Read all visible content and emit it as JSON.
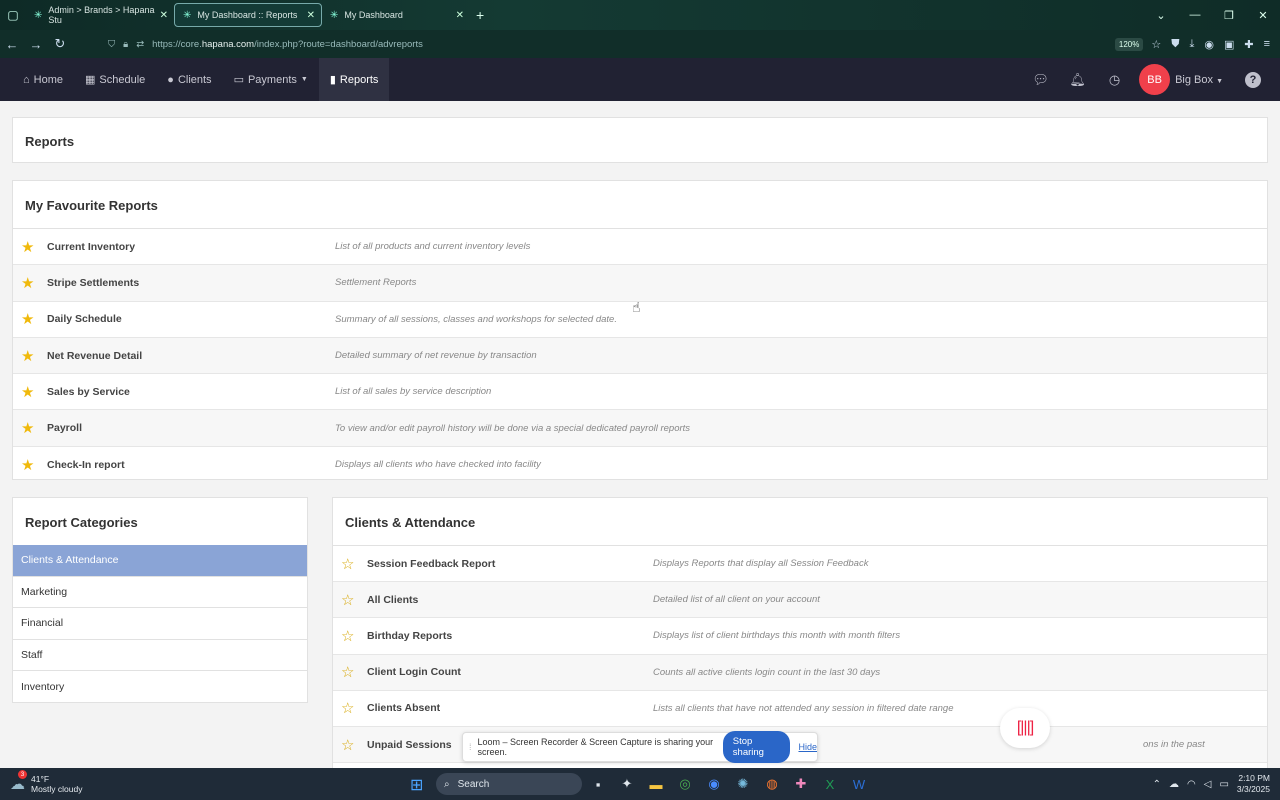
{
  "browser": {
    "tabs": [
      {
        "label": "Admin > Brands > Hapana Stu",
        "active": false
      },
      {
        "label": "My Dashboard :: Reports",
        "active": true
      },
      {
        "label": "My Dashboard",
        "active": false
      }
    ],
    "url_prefix": "https://core.",
    "url_host": "hapana.com",
    "url_path": "/index.php?route=dashboard/advreports",
    "zoom": "120%"
  },
  "nav": {
    "items": [
      {
        "label": "Home",
        "icon": "home-icon"
      },
      {
        "label": "Schedule",
        "icon": "calendar-icon"
      },
      {
        "label": "Clients",
        "icon": "user-icon"
      },
      {
        "label": "Payments",
        "icon": "payment-icon"
      },
      {
        "label": "Reports",
        "icon": "bar-chart-icon"
      }
    ],
    "active": "Reports",
    "avatar_initials": "BB",
    "user_name": "Big Box",
    "help": "?"
  },
  "page": {
    "title": "Reports",
    "favourites_title": "My Favourite Reports",
    "favourites": [
      {
        "name": "Current Inventory",
        "desc": "List of all products and current inventory levels"
      },
      {
        "name": "Stripe Settlements",
        "desc": "Settlement Reports"
      },
      {
        "name": "Daily Schedule",
        "desc": "Summary of all sessions, classes and workshops for selected date."
      },
      {
        "name": "Net Revenue Detail",
        "desc": "Detailed summary of net revenue by transaction"
      },
      {
        "name": "Sales by Service",
        "desc": "List of all sales by service description"
      },
      {
        "name": "Payroll",
        "desc": "To view and/or edit payroll history will be done via a special dedicated payroll reports"
      },
      {
        "name": "Check-In report",
        "desc": "Displays all clients who have checked into facility"
      }
    ],
    "categories_title": "Report Categories",
    "categories": [
      "Clients & Attendance",
      "Marketing",
      "Financial",
      "Staff",
      "Inventory"
    ],
    "active_category": "Clients & Attendance",
    "category_panel_title": "Clients & Attendance",
    "category_reports": [
      {
        "name": "Session Feedback Report",
        "desc": "Displays Reports that display all Session Feedback"
      },
      {
        "name": "All Clients",
        "desc": "Detailed list of all client on your account"
      },
      {
        "name": "Birthday Reports",
        "desc": "Displays list of client birthdays this month with month filters"
      },
      {
        "name": "Client Login Count",
        "desc": "Counts all active clients login count in the last 30 days"
      },
      {
        "name": "Clients Absent",
        "desc": "Lists all clients that have not attended any session in filtered date range"
      },
      {
        "name": "Unpaid Sessions",
        "desc": "ons in the past"
      }
    ]
  },
  "loom": {
    "message": "Loom – Screen Recorder & Screen Capture is sharing your screen.",
    "stop_label": "Stop sharing",
    "hide_label": "Hide"
  },
  "taskbar": {
    "weather_badge": "3",
    "temp": "41°F",
    "condition": "Mostly cloudy",
    "search_label": "Search",
    "time": "2:10 PM",
    "date": "3/3/2025"
  }
}
